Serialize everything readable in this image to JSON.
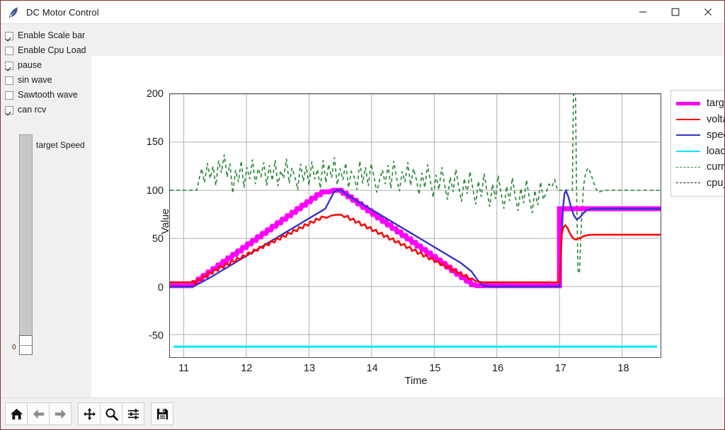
{
  "window": {
    "title": "DC Motor Control",
    "app_icon": "feather-icon",
    "controls": {
      "minimize": "—",
      "maximize": "☐",
      "close": "✕"
    }
  },
  "controls_panel": {
    "checkboxes": [
      {
        "label": "Enable Scale bar",
        "checked": true
      },
      {
        "label": "Enable Cpu Load",
        "checked": false
      },
      {
        "label": "pause",
        "checked": true
      },
      {
        "label": "sin wave",
        "checked": false
      },
      {
        "label": "Sawtooth wave",
        "checked": false
      },
      {
        "label": "can rcv",
        "checked": true
      }
    ],
    "slider": {
      "label": "target Speed",
      "value": "0",
      "min": 0,
      "max": 200,
      "orientation": "vertical"
    }
  },
  "toolbar": {
    "buttons": [
      {
        "name": "home-icon",
        "tooltip": "Home"
      },
      {
        "name": "arrow-left-icon",
        "tooltip": "Back"
      },
      {
        "name": "arrow-right-icon",
        "tooltip": "Forward"
      },
      {
        "name": "move-icon",
        "tooltip": "Pan"
      },
      {
        "name": "magnifier-icon",
        "tooltip": "Zoom"
      },
      {
        "name": "sliders-icon",
        "tooltip": "Configure subplots"
      },
      {
        "name": "save-icon",
        "tooltip": "Save"
      }
    ]
  },
  "chart_data": {
    "type": "line",
    "title": "",
    "xlabel": "Time",
    "ylabel": "Value",
    "xlim": [
      10.78,
      18.62
    ],
    "ylim": [
      -73,
      200
    ],
    "xticks": [
      11,
      12,
      13,
      14,
      15,
      16,
      17,
      18
    ],
    "yticks": [
      -50,
      0,
      50,
      100,
      150,
      200
    ],
    "grid": true,
    "legend_position": "upper-right-outside",
    "colors": {
      "target": "#ff00ff",
      "voltage": "#ff0000",
      "speed": "#3333cc",
      "loadTorque": "#00e5ff",
      "current": "#2e8b3a",
      "cpu_load": "#1a1a1a"
    },
    "series": [
      {
        "name": "targetSpeed",
        "legend_label": "target",
        "color": "#ff00ff",
        "style": "solid",
        "width": 5,
        "description": "stair-stepped trapezoid then step to 80",
        "points": [
          [
            10.78,
            1
          ],
          [
            11.1,
            1
          ],
          [
            11.18,
            3
          ],
          [
            11.35,
            10
          ],
          [
            11.6,
            20
          ],
          [
            11.9,
            32
          ],
          [
            12.2,
            44
          ],
          [
            12.5,
            55
          ],
          [
            12.8,
            67
          ],
          [
            13.1,
            79
          ],
          [
            13.35,
            92
          ],
          [
            13.45,
            100
          ],
          [
            13.72,
            100
          ],
          [
            13.8,
            97
          ],
          [
            14.1,
            85
          ],
          [
            14.4,
            73
          ],
          [
            14.7,
            61
          ],
          [
            15.0,
            49
          ],
          [
            15.3,
            37
          ],
          [
            15.6,
            22
          ],
          [
            15.85,
            6
          ],
          [
            15.95,
            1
          ],
          [
            16.9,
            1
          ],
          [
            16.99,
            1
          ],
          [
            17.02,
            80
          ],
          [
            18.62,
            80
          ]
        ]
      },
      {
        "name": "voltage",
        "legend_label": "voltage",
        "color": "#ff0000",
        "style": "solid",
        "width": 2.2,
        "points": [
          [
            10.78,
            5
          ],
          [
            11.12,
            5
          ],
          [
            11.2,
            6
          ],
          [
            11.5,
            13
          ],
          [
            11.8,
            22
          ],
          [
            12.1,
            31
          ],
          [
            12.4,
            39
          ],
          [
            12.7,
            47
          ],
          [
            13.0,
            55
          ],
          [
            13.3,
            64
          ],
          [
            13.55,
            69
          ],
          [
            13.72,
            70
          ],
          [
            13.8,
            66
          ],
          [
            14.1,
            57
          ],
          [
            14.4,
            49
          ],
          [
            14.7,
            41
          ],
          [
            15.0,
            33
          ],
          [
            15.3,
            25
          ],
          [
            15.6,
            14
          ],
          [
            15.85,
            6
          ],
          [
            15.95,
            5
          ],
          [
            16.95,
            5
          ],
          [
            17.0,
            5
          ],
          [
            17.04,
            60
          ],
          [
            17.1,
            68
          ],
          [
            17.16,
            66
          ],
          [
            17.23,
            57
          ],
          [
            17.3,
            54
          ],
          [
            17.42,
            57
          ],
          [
            17.6,
            57
          ],
          [
            18.62,
            57
          ]
        ]
      },
      {
        "name": "speed",
        "legend_label": "speed",
        "color": "#3333cc",
        "style": "solid",
        "width": 2.0,
        "points": [
          [
            10.78,
            0
          ],
          [
            11.14,
            0
          ],
          [
            11.25,
            5
          ],
          [
            11.55,
            16
          ],
          [
            11.85,
            29
          ],
          [
            12.15,
            41
          ],
          [
            12.45,
            52
          ],
          [
            12.75,
            64
          ],
          [
            13.05,
            76
          ],
          [
            13.35,
            89
          ],
          [
            13.5,
            100
          ],
          [
            13.72,
            100
          ],
          [
            13.82,
            96
          ],
          [
            14.1,
            84
          ],
          [
            14.4,
            72
          ],
          [
            14.7,
            60
          ],
          [
            15.0,
            48
          ],
          [
            15.3,
            36
          ],
          [
            15.6,
            21
          ],
          [
            15.85,
            4
          ],
          [
            15.95,
            0
          ],
          [
            16.95,
            0
          ],
          [
            17.0,
            0
          ],
          [
            17.06,
            60
          ],
          [
            17.12,
            100
          ],
          [
            17.18,
            96
          ],
          [
            17.25,
            82
          ],
          [
            17.32,
            74
          ],
          [
            17.42,
            78
          ],
          [
            17.55,
            80
          ],
          [
            17.8,
            80
          ],
          [
            18.62,
            80
          ]
        ]
      },
      {
        "name": "loadTorque",
        "legend_label": "loadTorque",
        "color": "#00e5ff",
        "style": "solid",
        "width": 2.6,
        "constant_value": -63,
        "points": [
          [
            10.82,
            -63
          ],
          [
            18.58,
            -63
          ]
        ]
      },
      {
        "name": "current",
        "legend_label": "current",
        "color": "#2e8b3a",
        "style": "dashed",
        "width": 1.6,
        "description": "flat 100, noisy 100-150 band during ramps, off-scale spike at step",
        "baseline": 100,
        "band": [
          95,
          152
        ],
        "spike": {
          "x": 17.02,
          "high": 215,
          "low": 20
        }
      },
      {
        "name": "cpu_load",
        "legend_label": "cpu_load",
        "color": "#1a1a1a",
        "style": "dashed",
        "width": 1.6,
        "visible": false,
        "points": []
      }
    ]
  },
  "legend": {
    "items": [
      {
        "label": "target",
        "color": "#ff00ff",
        "style": "solid",
        "width": 5
      },
      {
        "label": "voltage",
        "color": "#ff0000",
        "style": "solid",
        "width": 2.4
      },
      {
        "label": "speed",
        "color": "#3333cc",
        "style": "solid",
        "width": 2.2
      },
      {
        "label": "loadTorque",
        "color": "#00e5ff",
        "style": "solid",
        "width": 2.6
      },
      {
        "label": "current",
        "color": "#2e8b3a",
        "style": "dashed",
        "width": 1.8
      },
      {
        "label": "cpu_load",
        "color": "#1a1a1a",
        "style": "dashed",
        "width": 1.8
      }
    ]
  }
}
